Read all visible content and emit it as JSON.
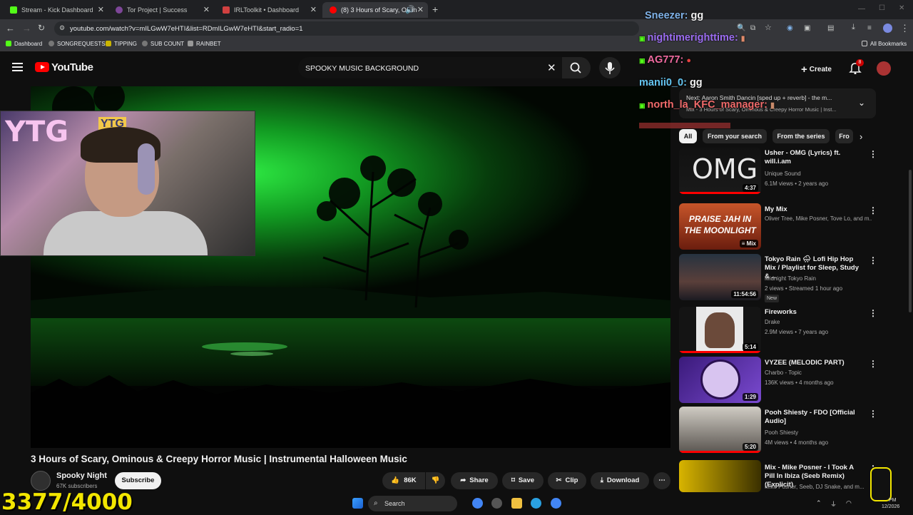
{
  "browser": {
    "tabs": [
      {
        "label": "Stream - Kick Dashboard",
        "icon": "kick-icon",
        "color": "#53fc18"
      },
      {
        "label": "Tor Project | Success",
        "icon": "tor-icon",
        "color": "#7d4698"
      },
      {
        "label": "IRLToolkit • Dashboard",
        "icon": "irltoolkit-icon",
        "color": "#d04040"
      },
      {
        "label": "(8) 3 Hours of Scary, Omin",
        "icon": "youtube-icon",
        "color": "#ff0000"
      }
    ],
    "active_tab": 3,
    "url": "youtube.com/watch?v=mILGwW7eHTI&list=RDmILGwW7eHTI&start_radio=1",
    "bookmarks": [
      {
        "label": "Dashboard",
        "icon": "kick-icon"
      },
      {
        "label": "SONGREQUESTS",
        "icon": "bookmark-icon"
      },
      {
        "label": "TIPPING",
        "icon": "bookmark-icon"
      },
      {
        "label": "SUB COUNT",
        "icon": "bookmark-icon"
      },
      {
        "label": "RAINBET",
        "icon": "bookmark-icon"
      }
    ],
    "all_bookmarks": "All Bookmarks"
  },
  "youtube": {
    "logo_text": "YouTube",
    "search_value": "SPOOKY MUSIC BACKGROUND",
    "create_label": "Create",
    "notification_count": "8",
    "brand_color": "#ff0000"
  },
  "video": {
    "title": "3 Hours of Scary, Ominous & Creepy Horror Music | Instrumental Halloween Music",
    "channel": "Spooky Night",
    "subscribers": "67K subscribers",
    "subscribe_label": "Subscribe",
    "likes": "86K",
    "share_label": "Share",
    "save_label": "Save",
    "clip_label": "Clip",
    "download_label": "Download"
  },
  "webcam": {
    "sign_text": "YTG",
    "sign_text_2": "YTG"
  },
  "chat": [
    {
      "user": "Sneezer:",
      "message": "gg",
      "color": "#7fb2e8"
    },
    {
      "user": "nightimerighttime:",
      "message": "",
      "color": "#9b6cf0"
    },
    {
      "user": "AG777:",
      "message": "",
      "color": "#f06aa0"
    },
    {
      "user": "manii0_0:",
      "message": "gg",
      "color": "#63c4f0"
    },
    {
      "user": "north_la_KFC_manager:",
      "message": "",
      "color": "#f06a6a"
    }
  ],
  "up_next": {
    "line1": "Next: Aaron Smith Dancin [sped up + reverb] - the m...",
    "line2": "Mix - 3 Hours of Scary, Ominous & Creepy Horror Music | Inst..."
  },
  "chips": [
    "All",
    "From your search",
    "From the series",
    "Fro"
  ],
  "sidebar_videos": [
    {
      "title": "Usher - OMG (Lyrics) ft. will.i.am",
      "channel": "Unique Sound",
      "meta": "6.1M views • 2 years ago",
      "duration": "4:37",
      "thumb_text": "OMG",
      "badge": ""
    },
    {
      "title": "My Mix",
      "channel": "Oliver Tree, Mike Posner, Tove Lo, and m...",
      "meta": "",
      "duration": "Mix",
      "thumb_text": "PRAISE JAH IN THE MOONLIGHT",
      "badge": ""
    },
    {
      "title": "Tokyo Rain 🌧 Lofi Hip Hop Mix / Playlist for Sleep, Study & ...",
      "channel": "Midnight Tokyo Rain",
      "meta": "2 views • Streamed 1 hour ago",
      "duration": "11:54:56",
      "thumb_text": "",
      "badge": "New"
    },
    {
      "title": "Fireworks",
      "channel": "Drake",
      "meta": "2.9M views • 7 years ago",
      "duration": "5:14",
      "thumb_text": "",
      "badge": ""
    },
    {
      "title": "VYZEE (MELODIC PART)",
      "channel": "Charbo - Topic",
      "meta": "136K views • 4 months ago",
      "duration": "1:29",
      "thumb_text": "",
      "badge": ""
    },
    {
      "title": "Pooh Shiesty - FDO [Official Audio]",
      "channel": "Pooh Shiesty",
      "meta": "4M views • 4 months ago",
      "duration": "5:20",
      "thumb_text": "",
      "badge": ""
    },
    {
      "title": "Mix - Mike Posner - I Took A Pill In Ibiza (Seeb Remix) (Explicit)",
      "channel": "Mike Posner, Seeb, DJ Snake, and m...",
      "meta": "",
      "duration": "",
      "thumb_text": "",
      "badge": ""
    }
  ],
  "overlay": {
    "counter": "3377/4000"
  },
  "taskbar": {
    "search_label": "Search",
    "date": "12/2026",
    "time": "PM"
  }
}
